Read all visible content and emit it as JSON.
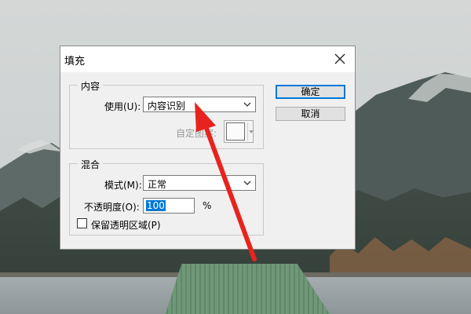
{
  "dialog": {
    "title": "填充",
    "content_group": {
      "legend": "内容",
      "use_label": "使用(U):",
      "use_value": "内容识别",
      "custom_pattern_label": "自定图案:"
    },
    "blend_group": {
      "legend": "混合",
      "mode_label": "模式(M):",
      "mode_value": "正常",
      "opacity_label": "不透明度(O):",
      "opacity_value": "100",
      "opacity_unit": "%",
      "preserve_transparency_label": "保留透明区域(P)",
      "preserve_transparency_checked": false
    },
    "buttons": {
      "ok": "确定",
      "cancel": "取消"
    }
  },
  "colors": {
    "annotation_arrow": "#e8231e",
    "selection": "#0078d7",
    "primary_button_border": "#0078d7"
  },
  "icons": [
    "close-icon",
    "chevron-down-icon",
    "annotation-arrow"
  ]
}
